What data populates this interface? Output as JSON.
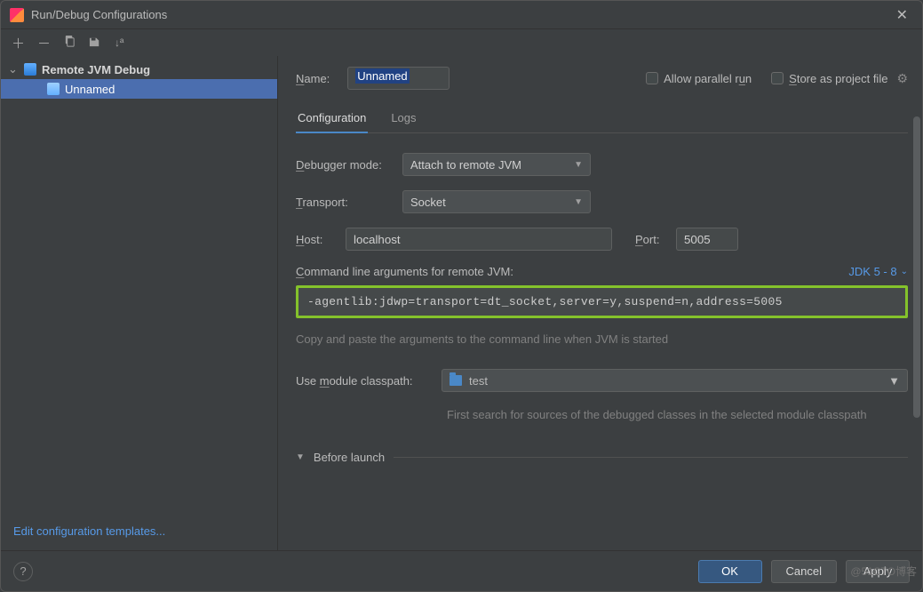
{
  "window": {
    "title": "Run/Debug Configurations"
  },
  "tree": {
    "parent": "Remote JVM Debug",
    "child": "Unnamed"
  },
  "leftLink": "Edit configuration templates...",
  "header": {
    "nameLabel": "Name:",
    "nameValue": "Unnamed",
    "allowParallel": "Allow parallel run",
    "storeAsFile": "Store as project file"
  },
  "tabs": {
    "config": "Configuration",
    "logs": "Logs"
  },
  "form": {
    "debuggerModeLabel": "Debugger mode:",
    "debuggerModeValue": "Attach to remote JVM",
    "transportLabel": "Transport:",
    "transportValue": "Socket",
    "hostLabel": "Host:",
    "hostValue": "localhost",
    "portLabel": "Port:",
    "portValue": "5005",
    "cmdLabel": "Command line arguments for remote JVM:",
    "jdkLabel": "JDK 5 - 8",
    "cmdValue": "-agentlib:jdwp=transport=dt_socket,server=y,suspend=n,address=5005",
    "hint1": "Copy and paste the arguments to the command line when JVM is started",
    "moduleLabel": "Use module classpath:",
    "moduleValue": "test",
    "hint2": "First search for sources of the debugged classes in the selected module classpath",
    "beforeLaunch": "Before launch"
  },
  "buttons": {
    "ok": "OK",
    "cancel": "Cancel",
    "apply": "Apply"
  },
  "watermark": "@51CTO博客"
}
